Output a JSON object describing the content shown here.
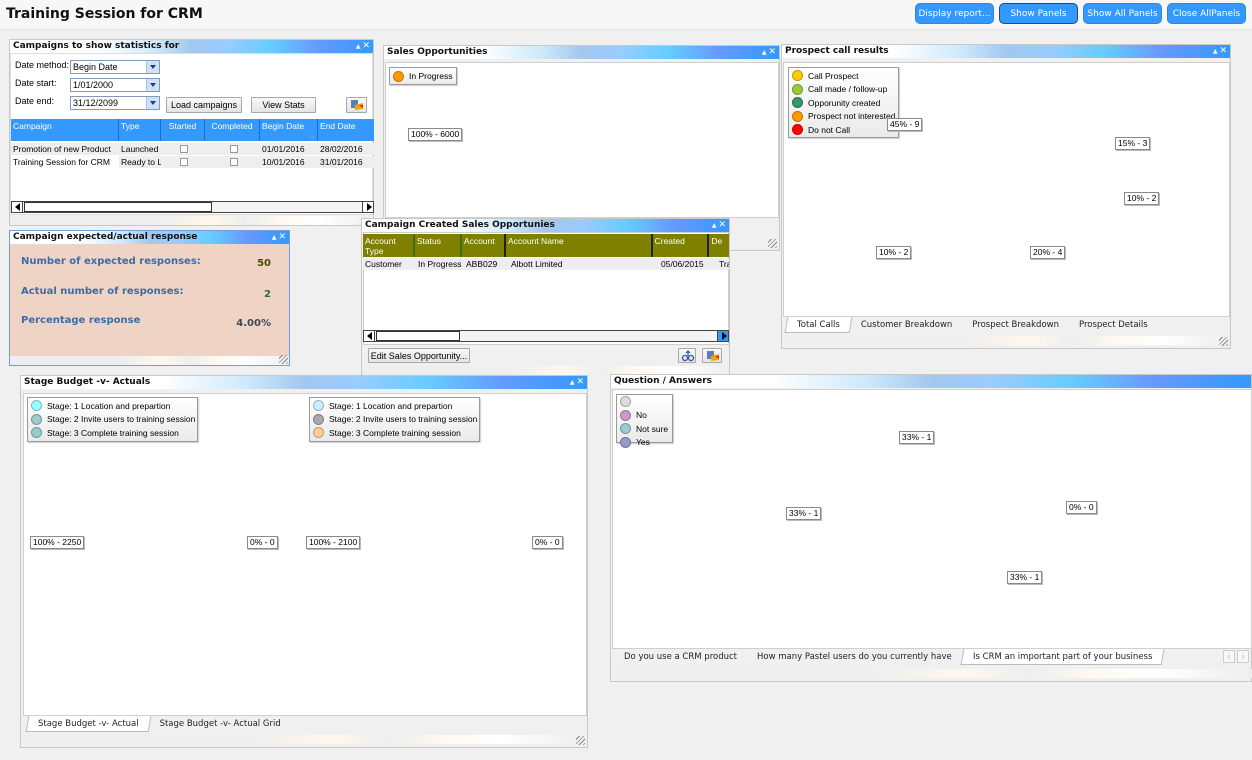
{
  "app": {
    "title": "Training Session for CRM"
  },
  "toolbar": {
    "display_report": "Display report...",
    "show_panels": "Show Panels",
    "show_all_panels": "Show All Panels",
    "close_all_panels": "Close AllPanels"
  },
  "panel_controls": {
    "collapse": "▲",
    "close": "✕"
  },
  "campaigns_panel": {
    "title": "Campaigns to show statistics for",
    "date_method_label": "Date method:",
    "date_method_value": "Begin Date",
    "date_start_label": "Date start:",
    "date_start_value": "1/01/2000",
    "date_end_label": "Date end:",
    "date_end_value": "31/12/2099",
    "load_campaigns": "Load campaigns",
    "view_stats": "View Stats",
    "columns": [
      "Campaign",
      "Type",
      "Started",
      "Completed",
      "Begin Date",
      "End Date"
    ],
    "sort_indicator": "▵",
    "rows": [
      {
        "campaign": "Promotion of new Product",
        "type": "Launched",
        "started": false,
        "completed": false,
        "begin": "01/01/2016",
        "end": "28/02/2016"
      },
      {
        "campaign": "Training Session for CRM",
        "type": "Ready to L",
        "started": false,
        "completed": false,
        "begin": "10/01/2016",
        "end": "31/01/2016"
      }
    ]
  },
  "response_panel": {
    "title": "Campaign expected/actual response",
    "expected_label": "Number of expected responses:",
    "expected_value": "50",
    "actual_label": "Actual number of responses:",
    "actual_value": "2",
    "percentage_label": "Percentage response",
    "percentage_value": "4.00%"
  },
  "sales_opp_panel": {
    "title": "Sales Opportunities",
    "legend": [
      {
        "label": "In Progress",
        "color": "#ff9900"
      }
    ]
  },
  "created_opps_panel": {
    "title": "Campaign Created Sales Opportunies",
    "columns": [
      "Account Type",
      "Status",
      "Account",
      "Account Name",
      "Created",
      "De"
    ],
    "rows": [
      {
        "account_type": "Customer",
        "status": "In Progress",
        "account": "ABB029",
        "account_name": "Albott Limited",
        "created": "05/06/2015",
        "de": "Tra"
      }
    ],
    "edit_button": "Edit Sales Opportunity..."
  },
  "prospect_panel": {
    "title": "Prospect call results",
    "legend": [
      {
        "label": "Call Prospect",
        "color": "#ffcc00"
      },
      {
        "label": "Call made / follow-up",
        "color": "#99cc33"
      },
      {
        "label": "Opporunity created",
        "color": "#339966"
      },
      {
        "label": "Prospect not interested",
        "color": "#ff9900"
      },
      {
        "label": "Do not Call",
        "color": "#ff0000"
      }
    ],
    "tabs": [
      "Total Calls",
      "Customer Breakdown",
      "Prospect Breakdown",
      "Prospect Details"
    ],
    "selected_tab": 0
  },
  "stage_panel": {
    "title": "Stage Budget -v- Actuals",
    "legend_left": [
      {
        "label": "Stage: 1 Location and prepartion",
        "color": "#99ffff"
      },
      {
        "label": "Stage: 2 Invite users to training session",
        "color": "#99cccc"
      },
      {
        "label": "Stage: 3 Complete training session",
        "color": "#99cccc"
      }
    ],
    "legend_right": [
      {
        "label": "Stage: 1 Location and prepartion",
        "color": "#cceeff"
      },
      {
        "label": "Stage: 2 Invite users to training session",
        "color": "#aaaaaa"
      },
      {
        "label": "Stage: 3 Complete training session",
        "color": "#ffcc99"
      }
    ],
    "tabs": [
      "Stage Budget -v- Actual",
      "Stage Budget -v- Actual Grid"
    ],
    "selected_tab": 0
  },
  "qa_panel": {
    "title": "Question / Answers",
    "legend": [
      {
        "label": "",
        "color": "#dddddd"
      },
      {
        "label": "No",
        "color": "#cc99cc"
      },
      {
        "label": "Not sure",
        "color": "#99cccc"
      },
      {
        "label": "Yes",
        "color": "#9999cc"
      }
    ],
    "tabs": [
      "Do you use a CRM product",
      "How many Pastel users do you currently have",
      "Is CRM an important part of your business"
    ],
    "selected_tab": 2
  },
  "chart_data": [
    {
      "type": "pie",
      "title": "Sales Opportunities",
      "categories": [
        "In Progress"
      ],
      "values": [
        6000
      ],
      "labels": [
        "100% - 6000"
      ]
    },
    {
      "type": "pie",
      "title": "Prospect call results",
      "categories": [
        "Call Prospect",
        "Call made / follow-up",
        "Opporunity created",
        "Prospect not interested",
        "Do not Call"
      ],
      "values": [
        3,
        9,
        2,
        4,
        2
      ],
      "percent": [
        15,
        45,
        10,
        20,
        10
      ],
      "labels": [
        "15% - 3",
        "45% - 9",
        "10% - 2",
        "20% - 4",
        "10% - 2"
      ],
      "exploded": "Opporunity created"
    },
    {
      "type": "pie",
      "title": "Stage Budget",
      "categories": [
        "Stage: 1 Location and prepartion",
        "Stage: 2 Invite users to training session",
        "Stage: 3 Complete training session"
      ],
      "values": [
        2250,
        0,
        0
      ],
      "labels": [
        "100% - 2250",
        "0% - 0"
      ]
    },
    {
      "type": "pie",
      "title": "Stage Actual",
      "categories": [
        "Stage: 1 Location and prepartion",
        "Stage: 2 Invite users to training session",
        "Stage: 3 Complete training session"
      ],
      "values": [
        2100,
        0,
        0
      ],
      "labels": [
        "100% - 2100",
        "0% - 0"
      ]
    },
    {
      "type": "pie",
      "title": "Is CRM an important part of your business",
      "categories": [
        "",
        "No",
        "Not sure",
        "Yes"
      ],
      "values": [
        0,
        1,
        1,
        1
      ],
      "labels": [
        "0% - 0",
        "33% - 1",
        "33% - 1",
        "33% - 1"
      ]
    }
  ]
}
